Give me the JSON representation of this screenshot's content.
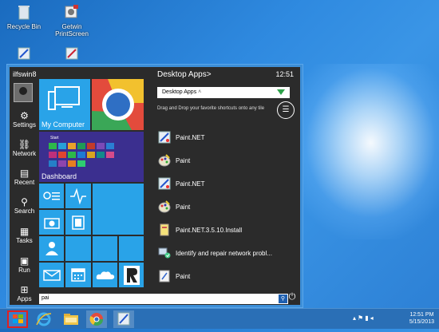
{
  "desktop": {
    "icons": [
      {
        "label": "Recycle Bin"
      },
      {
        "label": "Getwin PrintScreen"
      }
    ]
  },
  "menu": {
    "user_name": "ilfswin8",
    "nav": [
      {
        "label": "Settings",
        "icon": "gear-icon"
      },
      {
        "label": "Network",
        "icon": "network-icon"
      },
      {
        "label": "Recent",
        "icon": "recent-icon"
      },
      {
        "label": "Search",
        "icon": "search-icon"
      },
      {
        "label": "Tasks",
        "icon": "tasks-icon"
      },
      {
        "label": "Run",
        "icon": "run-icon"
      },
      {
        "label": "Apps",
        "icon": "apps-icon"
      }
    ],
    "tiles": {
      "my_computer": "My Computer",
      "dashboard": "Dashboard",
      "start_label": "Start"
    },
    "right": {
      "title": "Desktop Apps>",
      "time": "12:51",
      "dropdown_value": "Desktop Apps",
      "hint": "Drag and Drop your favorite shortcuts onto any tile",
      "apps": [
        {
          "label": "Paint.NET",
          "icon": "paintnet-icon"
        },
        {
          "label": "Paint",
          "icon": "paint-icon"
        },
        {
          "label": "Paint.NET",
          "icon": "paintnet-icon"
        },
        {
          "label": "Paint",
          "icon": "paint-icon"
        },
        {
          "label": "Paint.NET.3.5.10.Install",
          "icon": "installer-icon"
        },
        {
          "label": "Identify and repair network probl...",
          "icon": "network-repair-icon"
        },
        {
          "label": "Paint",
          "icon": "paint-icon"
        }
      ]
    },
    "search_value": "pai"
  },
  "taskbar": {
    "time": "12:51 PM",
    "date": "5/15/2013"
  },
  "colors": {
    "accent": "#29a3e8",
    "menu_bg": "#2b2b2b",
    "frame": "#3d8fd8"
  }
}
